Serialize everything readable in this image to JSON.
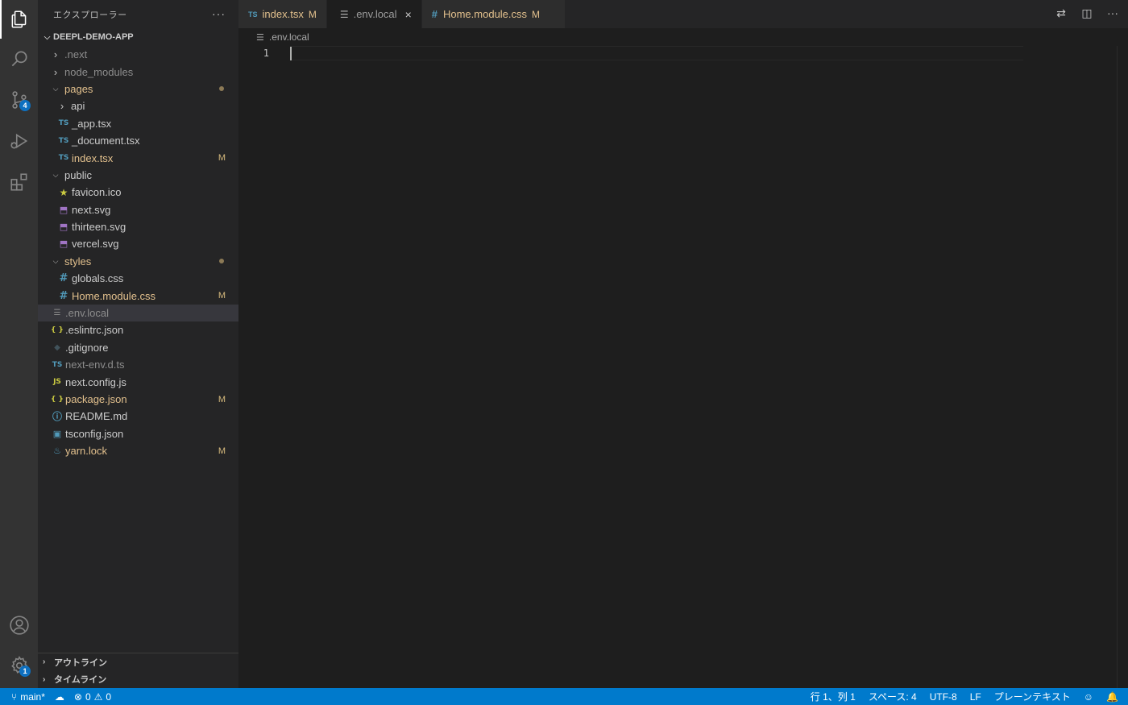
{
  "activity_bar": {
    "items": [
      {
        "name": "explorer",
        "icon": "files-icon",
        "active": true
      },
      {
        "name": "search",
        "icon": "search-icon"
      },
      {
        "name": "source-control",
        "icon": "source-control-icon",
        "badge": "4"
      },
      {
        "name": "run-debug",
        "icon": "run-debug-icon"
      },
      {
        "name": "extensions",
        "icon": "extensions-icon"
      }
    ],
    "bottom": [
      {
        "name": "accounts",
        "icon": "account-icon"
      },
      {
        "name": "manage",
        "icon": "gear-icon",
        "badge": "1"
      }
    ]
  },
  "sidebar": {
    "title": "エクスプローラー",
    "more": "···",
    "root": "DEEPL-DEMO-APP",
    "tree": [
      {
        "label": ".next",
        "kind": "folder",
        "expanded": false,
        "depth": 1,
        "style": "ignored"
      },
      {
        "label": "node_modules",
        "kind": "folder",
        "expanded": false,
        "depth": 1,
        "style": "ignored"
      },
      {
        "label": "pages",
        "kind": "folder",
        "expanded": true,
        "depth": 1,
        "style": "modified",
        "dot": true
      },
      {
        "label": "api",
        "kind": "folder",
        "expanded": false,
        "depth": 2,
        "style": "normal"
      },
      {
        "label": "_app.tsx",
        "kind": "ts",
        "depth": 2,
        "style": "normal"
      },
      {
        "label": "_document.tsx",
        "kind": "ts",
        "depth": 2,
        "style": "normal"
      },
      {
        "label": "index.tsx",
        "kind": "ts",
        "depth": 2,
        "style": "modified",
        "status": "M"
      },
      {
        "label": "public",
        "kind": "folder",
        "expanded": true,
        "depth": 1,
        "style": "normal"
      },
      {
        "label": "favicon.ico",
        "kind": "star",
        "depth": 2,
        "style": "normal"
      },
      {
        "label": "next.svg",
        "kind": "svg",
        "depth": 2,
        "style": "normal"
      },
      {
        "label": "thirteen.svg",
        "kind": "svg",
        "depth": 2,
        "style": "normal"
      },
      {
        "label": "vercel.svg",
        "kind": "svg",
        "depth": 2,
        "style": "normal"
      },
      {
        "label": "styles",
        "kind": "folder",
        "expanded": true,
        "depth": 1,
        "style": "modified",
        "dot": true
      },
      {
        "label": "globals.css",
        "kind": "css",
        "depth": 2,
        "style": "normal"
      },
      {
        "label": "Home.module.css",
        "kind": "css",
        "depth": 2,
        "style": "modified",
        "status": "M"
      },
      {
        "label": ".env.local",
        "kind": "text",
        "depth": 1,
        "style": "ignored",
        "selected": true
      },
      {
        "label": ".eslintrc.json",
        "kind": "json",
        "depth": 1,
        "style": "normal"
      },
      {
        "label": ".gitignore",
        "kind": "git",
        "depth": 1,
        "style": "normal"
      },
      {
        "label": "next-env.d.ts",
        "kind": "ts",
        "depth": 1,
        "style": "ignored"
      },
      {
        "label": "next.config.js",
        "kind": "js",
        "depth": 1,
        "style": "normal"
      },
      {
        "label": "package.json",
        "kind": "json",
        "depth": 1,
        "style": "modified",
        "status": "M"
      },
      {
        "label": "README.md",
        "kind": "info",
        "depth": 1,
        "style": "normal"
      },
      {
        "label": "tsconfig.json",
        "kind": "tsconfig",
        "depth": 1,
        "style": "normal"
      },
      {
        "label": "yarn.lock",
        "kind": "yarn",
        "depth": 1,
        "style": "modified",
        "status": "M"
      }
    ],
    "panels": [
      "アウトライン",
      "タイムライン"
    ]
  },
  "tabs": [
    {
      "label": "index.tsx",
      "icon": "TS",
      "status": "M",
      "active": false,
      "modified": true
    },
    {
      "label": ".env.local",
      "icon": "lines",
      "active": true,
      "close": "×"
    },
    {
      "label": "Home.module.css",
      "icon": "#",
      "status": "M",
      "active": false,
      "modified": true
    }
  ],
  "breadcrumb": ".env.local",
  "editor": {
    "line_numbers": [
      "1"
    ]
  },
  "statusbar": {
    "branch": "main*",
    "errors": "0",
    "warnings": "0",
    "position": "行 1、列 1",
    "spaces": "スペース: 4",
    "encoding": "UTF-8",
    "eol": "LF",
    "language": "プレーンテキスト"
  },
  "colors": {
    "accent": "#007acc",
    "modified": "#e2c08d",
    "ts_blue": "#519aba",
    "svg_purple": "#a074c4",
    "star_yellow": "#cbcb41",
    "json_yellow": "#cbcb41"
  }
}
